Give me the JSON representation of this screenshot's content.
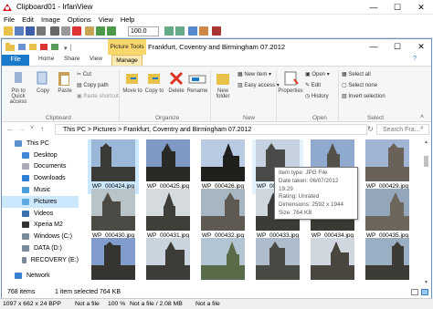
{
  "irfan": {
    "title": "Clipboard01 - IrfanView",
    "menu": [
      "File",
      "Edit",
      "Image",
      "Options",
      "View",
      "Help"
    ],
    "zoom": "100.0",
    "status": {
      "dims": "1097 x 662 x 24 BPP",
      "a": "Not a file",
      "zoom": "100 %",
      "b": "Not a file / 2.08 MB",
      "c": "Not a file"
    }
  },
  "explorer": {
    "picture_tools": "Picture Tools",
    "title": "Frankfurt, Coventry and Birmingham 07.2012",
    "tabs": {
      "file": "File",
      "home": "Home",
      "share": "Share",
      "view": "View",
      "manage": "Manage"
    },
    "ribbon": {
      "pin": "Pin to Quick access",
      "copy": "Copy",
      "paste": "Paste",
      "cut": "Cut",
      "copy_path": "Copy path",
      "paste_shortcut": "Paste shortcut",
      "move_to": "Move to",
      "copy_to": "Copy to",
      "delete": "Delete",
      "rename": "Rename",
      "new_folder": "New folder",
      "new_item": "New item",
      "easy_access": "Easy access",
      "properties": "Properties",
      "open": "Open",
      "edit": "Edit",
      "history": "History",
      "select_all": "Select all",
      "select_none": "Select none",
      "invert_selection": "Invert selection",
      "groups": {
        "clipboard": "Clipboard",
        "organize": "Organize",
        "new": "New",
        "open": "Open",
        "select": "Select"
      }
    },
    "address": {
      "this_pc": "This PC",
      "pictures": "Pictures",
      "folder": "Frankfurt, Coventry and Birmingham 07.2012"
    },
    "search_placeholder": "Search Fra...",
    "nav": [
      "This PC",
      "Desktop",
      "Documents",
      "Downloads",
      "Music",
      "Pictures",
      "Videos",
      "Xperia M2",
      "Windows (C:)",
      "DATA (D:)",
      "RECOVERY (E:)",
      "Network"
    ],
    "files": [
      "WP_000424.jpg",
      "WP_000425.jpg",
      "WP_000426.jpg",
      "WP_000427.jpg",
      "WP_000428.jpg",
      "WP_000429.jpg",
      "WP_000430.jpg",
      "WP_000431.jpg",
      "WP_000432.jpg",
      "WP_000433.jpg",
      "WP_000434.jpg",
      "WP_000435.jpg",
      "",
      "",
      "",
      "",
      "",
      ""
    ],
    "tooltip": {
      "type": "Item type: JPG File",
      "date": "Date taken: 06/07/2012 19:29",
      "rating": "Rating: Unrated",
      "dims": "Dimensions: 2592 x 1944",
      "size": "Size: 764 KB"
    },
    "status": {
      "items": "768 items",
      "selected": "1 item selected  764 KB"
    }
  },
  "colors": {
    "accent": "#1979ca",
    "selection": "#cce8ff",
    "picture_tools": "#f8d76d"
  }
}
